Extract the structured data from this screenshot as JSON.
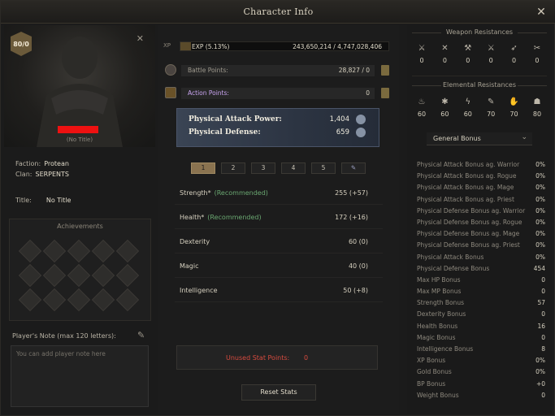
{
  "window": {
    "title": "Character Info",
    "close_icon": "close-icon"
  },
  "left": {
    "level": "80/0",
    "name_redacted": true,
    "title_small": "(No Title)",
    "faction_label": "Faction:",
    "faction_value": "Protean",
    "clan_label": "Clan:",
    "clan_value": "SERPENTS",
    "title_label": "Title:",
    "title_value": "No Title",
    "achievements_title": "Achievements",
    "achievement_count": 15,
    "note_label": "Player's Note (max 120 letters):",
    "note_placeholder": "You can add player note here"
  },
  "middle": {
    "xp_label": "XP",
    "exp_text": "EXP (5.13%)",
    "exp_percent": 5.13,
    "exp_value": "243,650,214 / 4,747,028,406",
    "battle_points_label": "Battle Points:",
    "battle_points_value": "28,827 / 0",
    "action_points_label": "Action Points:",
    "action_points_value": "0",
    "attack_power_label": "Physical Attack Power:",
    "attack_power_value": "1,404",
    "defense_label": "Physical Defense:",
    "defense_value": "659",
    "tabs": [
      "1",
      "2",
      "3",
      "4",
      "5"
    ],
    "active_tab": "1",
    "stats": [
      {
        "name": "Strength*",
        "rec": "(Recommended)",
        "value": "255 (+57)"
      },
      {
        "name": "Health*",
        "rec": "(Recommended)",
        "value": "172 (+16)"
      },
      {
        "name": "Dexterity",
        "rec": "",
        "value": "60 (0)"
      },
      {
        "name": "Magic",
        "rec": "",
        "value": "40 (0)"
      },
      {
        "name": "Intelligence",
        "rec": "",
        "value": "50 (+8)"
      }
    ],
    "unused_label": "Unused Stat Points:",
    "unused_value": "0",
    "reset_label": "Reset Stats"
  },
  "right": {
    "weapon_title": "Weapon Resistances",
    "weapon_res": [
      {
        "icon": "sword-icon",
        "value": "0"
      },
      {
        "icon": "crossed-axes-icon",
        "value": "0"
      },
      {
        "icon": "hammer-icon",
        "value": "0"
      },
      {
        "icon": "crossed-swords-icon",
        "value": "0"
      },
      {
        "icon": "bow-icon",
        "value": "0"
      },
      {
        "icon": "crossed-daggers-icon",
        "value": "0"
      }
    ],
    "elemental_title": "Elemental Resistances",
    "elemental_res": [
      {
        "icon": "fire-icon",
        "value": "60"
      },
      {
        "icon": "ice-icon",
        "value": "60"
      },
      {
        "icon": "lightning-icon",
        "value": "60"
      },
      {
        "icon": "brush-icon",
        "value": "70"
      },
      {
        "icon": "claw-icon",
        "value": "70"
      },
      {
        "icon": "poison-icon",
        "value": "80"
      }
    ],
    "dropdown_label": "General Bonus",
    "bonuses": [
      {
        "name": "Physical Attack Bonus ag. Warrior",
        "value": "0%"
      },
      {
        "name": "Physical Attack Bonus ag. Rogue",
        "value": "0%"
      },
      {
        "name": "Physical Attack Bonus ag. Mage",
        "value": "0%"
      },
      {
        "name": "Physical Attack Bonus ag. Priest",
        "value": "0%"
      },
      {
        "name": "Physical Defense Bonus ag. Warrior",
        "value": "0%"
      },
      {
        "name": "Physical Defense Bonus ag. Rogue",
        "value": "0%"
      },
      {
        "name": "Physical Defense Bonus ag. Mage",
        "value": "0%"
      },
      {
        "name": "Physical Defense Bonus ag. Priest",
        "value": "0%"
      },
      {
        "name": "Physical Attack Bonus",
        "value": "0%"
      },
      {
        "name": "Physical Defense Bonus",
        "value": "454"
      },
      {
        "name": "Max HP Bonus",
        "value": "0"
      },
      {
        "name": "Max MP Bonus",
        "value": "0"
      },
      {
        "name": "Strength Bonus",
        "value": "57"
      },
      {
        "name": "Dexterity Bonus",
        "value": "0"
      },
      {
        "name": "Health Bonus",
        "value": "16"
      },
      {
        "name": "Magic Bonus",
        "value": "0"
      },
      {
        "name": "Intelligence Bonus",
        "value": "8"
      },
      {
        "name": "XP Bonus",
        "value": "0%"
      },
      {
        "name": "Gold Bonus",
        "value": "0%"
      },
      {
        "name": "BP Bonus",
        "value": "+0"
      },
      {
        "name": "Weight Bonus",
        "value": "0"
      }
    ]
  }
}
